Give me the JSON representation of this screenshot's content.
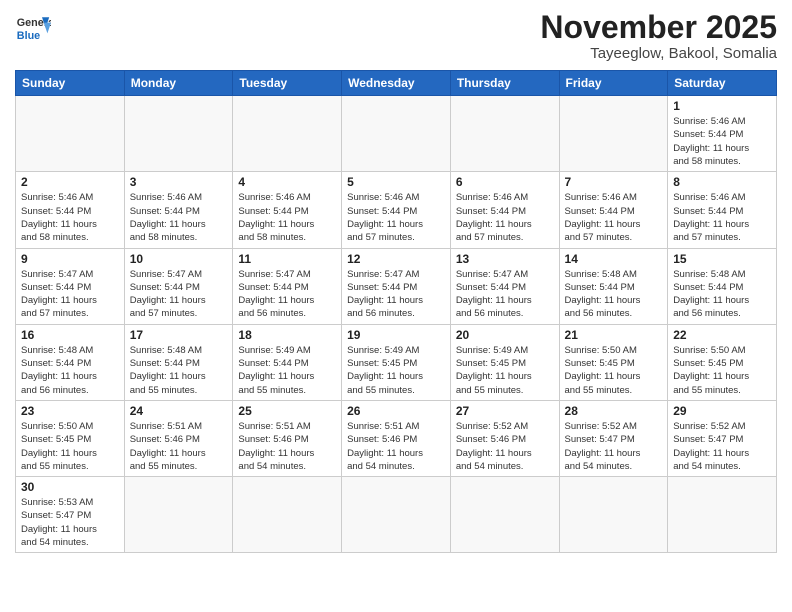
{
  "header": {
    "logo_line1": "General",
    "logo_line2": "Blue",
    "month_year": "November 2025",
    "location": "Tayeeglow, Bakool, Somalia"
  },
  "days_of_week": [
    "Sunday",
    "Monday",
    "Tuesday",
    "Wednesday",
    "Thursday",
    "Friday",
    "Saturday"
  ],
  "weeks": [
    [
      {
        "day": "",
        "info": ""
      },
      {
        "day": "",
        "info": ""
      },
      {
        "day": "",
        "info": ""
      },
      {
        "day": "",
        "info": ""
      },
      {
        "day": "",
        "info": ""
      },
      {
        "day": "",
        "info": ""
      },
      {
        "day": "1",
        "info": "Sunrise: 5:46 AM\nSunset: 5:44 PM\nDaylight: 11 hours\nand 58 minutes."
      }
    ],
    [
      {
        "day": "2",
        "info": "Sunrise: 5:46 AM\nSunset: 5:44 PM\nDaylight: 11 hours\nand 58 minutes."
      },
      {
        "day": "3",
        "info": "Sunrise: 5:46 AM\nSunset: 5:44 PM\nDaylight: 11 hours\nand 58 minutes."
      },
      {
        "day": "4",
        "info": "Sunrise: 5:46 AM\nSunset: 5:44 PM\nDaylight: 11 hours\nand 58 minutes."
      },
      {
        "day": "5",
        "info": "Sunrise: 5:46 AM\nSunset: 5:44 PM\nDaylight: 11 hours\nand 57 minutes."
      },
      {
        "day": "6",
        "info": "Sunrise: 5:46 AM\nSunset: 5:44 PM\nDaylight: 11 hours\nand 57 minutes."
      },
      {
        "day": "7",
        "info": "Sunrise: 5:46 AM\nSunset: 5:44 PM\nDaylight: 11 hours\nand 57 minutes."
      },
      {
        "day": "8",
        "info": "Sunrise: 5:46 AM\nSunset: 5:44 PM\nDaylight: 11 hours\nand 57 minutes."
      }
    ],
    [
      {
        "day": "9",
        "info": "Sunrise: 5:47 AM\nSunset: 5:44 PM\nDaylight: 11 hours\nand 57 minutes."
      },
      {
        "day": "10",
        "info": "Sunrise: 5:47 AM\nSunset: 5:44 PM\nDaylight: 11 hours\nand 57 minutes."
      },
      {
        "day": "11",
        "info": "Sunrise: 5:47 AM\nSunset: 5:44 PM\nDaylight: 11 hours\nand 56 minutes."
      },
      {
        "day": "12",
        "info": "Sunrise: 5:47 AM\nSunset: 5:44 PM\nDaylight: 11 hours\nand 56 minutes."
      },
      {
        "day": "13",
        "info": "Sunrise: 5:47 AM\nSunset: 5:44 PM\nDaylight: 11 hours\nand 56 minutes."
      },
      {
        "day": "14",
        "info": "Sunrise: 5:48 AM\nSunset: 5:44 PM\nDaylight: 11 hours\nand 56 minutes."
      },
      {
        "day": "15",
        "info": "Sunrise: 5:48 AM\nSunset: 5:44 PM\nDaylight: 11 hours\nand 56 minutes."
      }
    ],
    [
      {
        "day": "16",
        "info": "Sunrise: 5:48 AM\nSunset: 5:44 PM\nDaylight: 11 hours\nand 56 minutes."
      },
      {
        "day": "17",
        "info": "Sunrise: 5:48 AM\nSunset: 5:44 PM\nDaylight: 11 hours\nand 55 minutes."
      },
      {
        "day": "18",
        "info": "Sunrise: 5:49 AM\nSunset: 5:44 PM\nDaylight: 11 hours\nand 55 minutes."
      },
      {
        "day": "19",
        "info": "Sunrise: 5:49 AM\nSunset: 5:45 PM\nDaylight: 11 hours\nand 55 minutes."
      },
      {
        "day": "20",
        "info": "Sunrise: 5:49 AM\nSunset: 5:45 PM\nDaylight: 11 hours\nand 55 minutes."
      },
      {
        "day": "21",
        "info": "Sunrise: 5:50 AM\nSunset: 5:45 PM\nDaylight: 11 hours\nand 55 minutes."
      },
      {
        "day": "22",
        "info": "Sunrise: 5:50 AM\nSunset: 5:45 PM\nDaylight: 11 hours\nand 55 minutes."
      }
    ],
    [
      {
        "day": "23",
        "info": "Sunrise: 5:50 AM\nSunset: 5:45 PM\nDaylight: 11 hours\nand 55 minutes."
      },
      {
        "day": "24",
        "info": "Sunrise: 5:51 AM\nSunset: 5:46 PM\nDaylight: 11 hours\nand 55 minutes."
      },
      {
        "day": "25",
        "info": "Sunrise: 5:51 AM\nSunset: 5:46 PM\nDaylight: 11 hours\nand 54 minutes."
      },
      {
        "day": "26",
        "info": "Sunrise: 5:51 AM\nSunset: 5:46 PM\nDaylight: 11 hours\nand 54 minutes."
      },
      {
        "day": "27",
        "info": "Sunrise: 5:52 AM\nSunset: 5:46 PM\nDaylight: 11 hours\nand 54 minutes."
      },
      {
        "day": "28",
        "info": "Sunrise: 5:52 AM\nSunset: 5:47 PM\nDaylight: 11 hours\nand 54 minutes."
      },
      {
        "day": "29",
        "info": "Sunrise: 5:52 AM\nSunset: 5:47 PM\nDaylight: 11 hours\nand 54 minutes."
      }
    ],
    [
      {
        "day": "30",
        "info": "Sunrise: 5:53 AM\nSunset: 5:47 PM\nDaylight: 11 hours\nand 54 minutes."
      },
      {
        "day": "",
        "info": ""
      },
      {
        "day": "",
        "info": ""
      },
      {
        "day": "",
        "info": ""
      },
      {
        "day": "",
        "info": ""
      },
      {
        "day": "",
        "info": ""
      },
      {
        "day": "",
        "info": ""
      }
    ]
  ]
}
